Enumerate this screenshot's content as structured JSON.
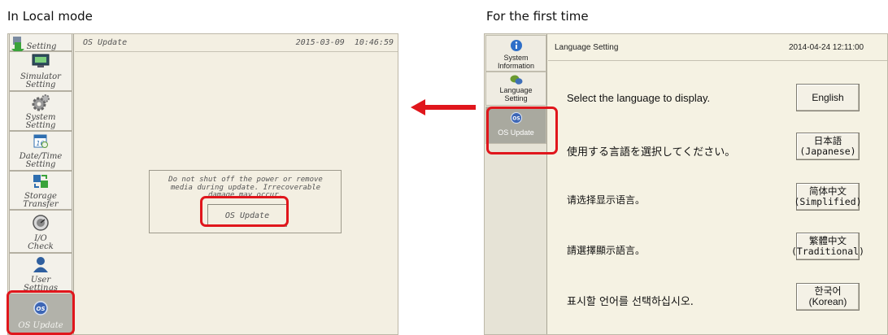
{
  "captions": {
    "left": "In Local mode",
    "right": "For the first time"
  },
  "local_mode": {
    "sidebar": {
      "items": [
        {
          "label": "Setting",
          "icon": "comm-setting-icon"
        },
        {
          "label": "Simulator\nSetting",
          "icon": "simulator-icon"
        },
        {
          "label": "System\nSetting",
          "icon": "gear-icon"
        },
        {
          "label": "Date/Time\nSetting",
          "icon": "calendar-icon"
        },
        {
          "label": "Storage\nTransfer",
          "icon": "storage-transfer-icon"
        },
        {
          "label": "I/O\nCheck",
          "icon": "io-check-icon"
        },
        {
          "label": "User\nSettings",
          "icon": "user-icon"
        },
        {
          "label": "OS Update",
          "icon": "os-update-icon",
          "selected": true
        }
      ]
    },
    "header": {
      "title": "OS Update",
      "datetime": "2015-03-09  10:46:59"
    },
    "dialog": {
      "message": "Do not shut off the power or remove\nmedia during update. Irrecoverable\ndamage may occur.",
      "button": "OS Update"
    },
    "highlight_color": "#e0161c"
  },
  "first_time": {
    "sidebar": {
      "items": [
        {
          "label": "System\nInformation",
          "icon": "info-icon"
        },
        {
          "label": "Language\nSetting",
          "icon": "language-icon"
        },
        {
          "label": "OS Update",
          "icon": "os-update-icon",
          "selected": true
        }
      ]
    },
    "header": {
      "title": "Language Setting",
      "datetime": "2014-04-24 12:11:00"
    },
    "languages": [
      {
        "prompt": "Select the language to display.",
        "button": [
          "English"
        ]
      },
      {
        "prompt": "使用する言語を選択してください。",
        "button": [
          "日本語",
          "(Japanese)"
        ]
      },
      {
        "prompt": "请选择显示语言。",
        "button": [
          "简体中文",
          "(Simplified)"
        ]
      },
      {
        "prompt": "請選擇顯示語言。",
        "button": [
          "繁體中文",
          "(Traditional)"
        ]
      },
      {
        "prompt": "표시할 언어를 선택하십시오.",
        "button": [
          "한국어",
          "(Korean)"
        ]
      }
    ]
  },
  "arrow_color": "#e0161c"
}
